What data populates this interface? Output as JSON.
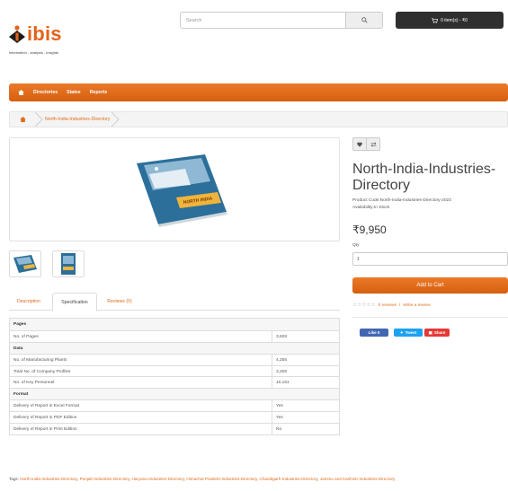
{
  "brand": {
    "name": "ibis",
    "tagline": "information - analysis - insights"
  },
  "header": {
    "search_placeholder": "Search",
    "search_icon": "search-icon",
    "cart_label": "0 item(s) - ₹0",
    "cart_icon": "cart-icon"
  },
  "menu": {
    "home_icon": "home-icon",
    "items": [
      "Directories",
      "States",
      "Reports"
    ]
  },
  "breadcrumb": {
    "home_icon": "home-icon",
    "current": "North-India-Industries-Directory"
  },
  "product": {
    "title": "North-India-Industries-Directory",
    "code_label": "Product Code:",
    "code": "North-India-Industries-Directory-2023",
    "availability_label": "Availability:",
    "availability": "In Stock",
    "price": "₹9,950",
    "qty_label": "Qty",
    "qty_value": "1",
    "add_to_cart": "Add to Cart",
    "reviews_link": "0 reviews",
    "write_review": "Write a review",
    "rating": 0,
    "rating_max": 5,
    "wishlist_icon": "heart-icon",
    "compare_icon": "compare-icon",
    "book_cover_text": "NORTH INDIA"
  },
  "tabs": [
    {
      "label": "Description"
    },
    {
      "label": "Specification"
    },
    {
      "label": "Reviews (0)"
    }
  ],
  "specification": [
    {
      "group": "Pages",
      "rows": [
        {
          "name": "No. of Pages",
          "value": "3,829"
        }
      ]
    },
    {
      "group": "Data",
      "rows": [
        {
          "name": "No. of Manufacturing Plants",
          "value": "4,255"
        },
        {
          "name": "Total No. of Company Profiles",
          "value": "3,206"
        },
        {
          "name": "No. of Key Personnel",
          "value": "10,161"
        }
      ]
    },
    {
      "group": "Format",
      "rows": [
        {
          "name": "Delivery of Report in Excel Format",
          "value": "Yes"
        },
        {
          "name": "Delivery of Report in PDF Edition",
          "value": "Yes"
        },
        {
          "name": "Delivery of Report in Print Edition",
          "value": "No"
        }
      ]
    }
  ],
  "social": {
    "like": "Like 0",
    "tweet": "Tweet",
    "share": "Share"
  },
  "tags": {
    "label": "Tags:",
    "items": [
      "North-India-Industries-Directory",
      "Punjab-Industries-Directory",
      "Haryana-Industries-Directory",
      "Himachal Pradesh-Industries-Directory",
      "Chandigarh-Industries-Directory",
      "Jammu and Kashmir-Industries-Directory"
    ]
  },
  "colors": {
    "accent": "#e06b1c",
    "menu_bar": "#df6a16",
    "cart_button": "#2f2f2f",
    "facebook": "#4267b2",
    "twitter": "#1da1f2",
    "share": "#e53935"
  }
}
